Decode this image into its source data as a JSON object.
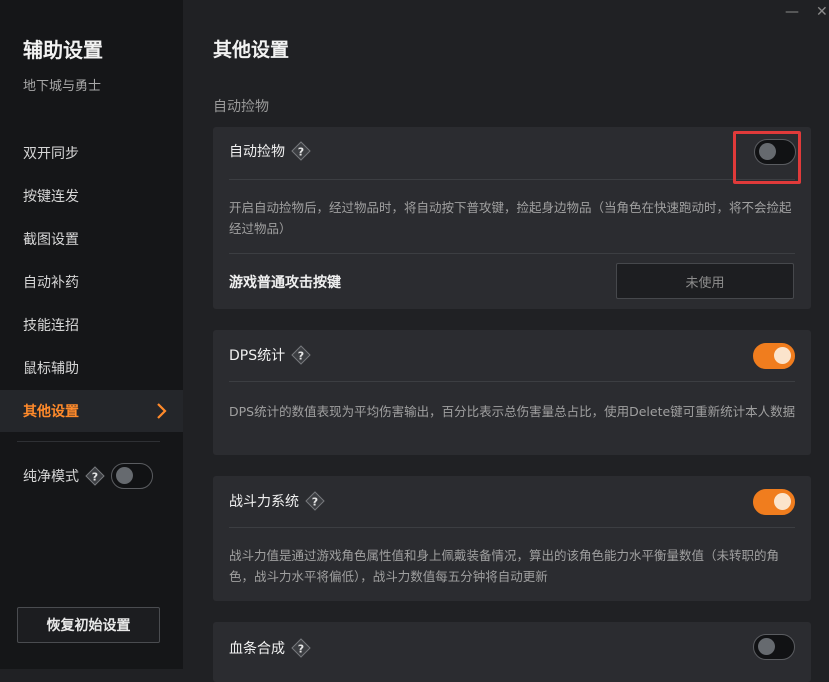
{
  "sidebar": {
    "title": "辅助设置",
    "subtitle": "地下城与勇士",
    "items": [
      {
        "label": "双开同步"
      },
      {
        "label": "按键连发"
      },
      {
        "label": "截图设置"
      },
      {
        "label": "自动补药"
      },
      {
        "label": "技能连招"
      },
      {
        "label": "鼠标辅助"
      },
      {
        "label": "其他设置",
        "active": true
      }
    ],
    "pure_mode": {
      "label": "纯净模式",
      "enabled": false
    },
    "reset_label": "恢复初始设置"
  },
  "window": {
    "minimize_glyph": "—",
    "close_glyph": "✕"
  },
  "main": {
    "title": "其他设置",
    "section_label": "自动捡物",
    "cards": [
      {
        "title": "自动捡物",
        "enabled": false,
        "description": "开启自动捡物后，经过物品时，将自动按下普攻键，捡起身边物品（当角色在快速跑动时，将不会捡起经过物品）",
        "key_setting": {
          "label": "游戏普通攻击按键",
          "value": "未使用"
        }
      },
      {
        "title": "DPS统计",
        "enabled": true,
        "description": "DPS统计的数值表现为平均伤害输出，百分比表示总伤害量总占比，使用Delete键可重新统计本人数据"
      },
      {
        "title": "战斗力系统",
        "enabled": true,
        "description": "战斗力值是通过游戏角色属性值和身上佩戴装备情况，算出的该角色能力水平衡量数值（未转职的角色，战斗力水平将偏低），战斗力数值每五分钟将自动更新"
      },
      {
        "title": "血条合成",
        "enabled": false
      }
    ]
  },
  "colors": {
    "accent": "#f07d1e",
    "highlight": "#e03a3a",
    "background": "#202124",
    "sidebar": "#151618",
    "card": "#2b2c30"
  }
}
